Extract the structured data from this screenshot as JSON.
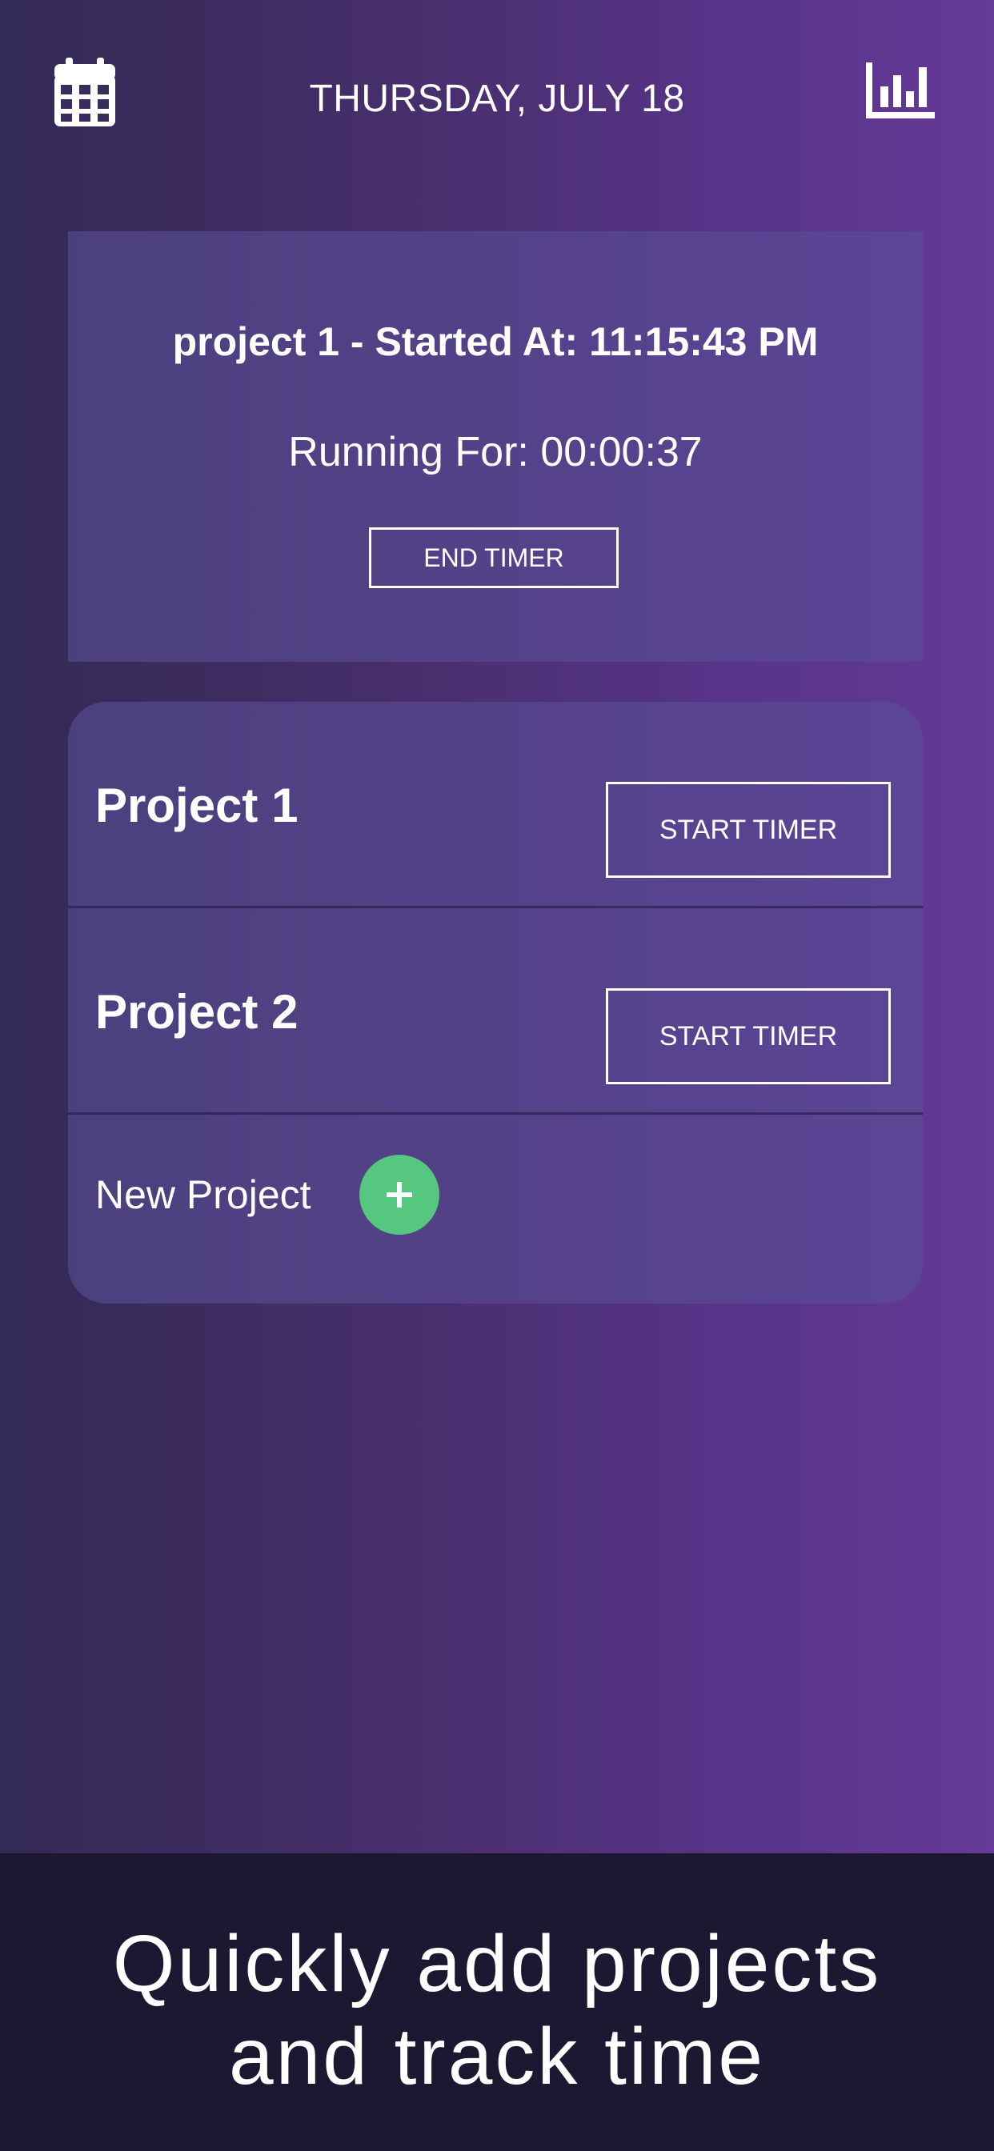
{
  "header": {
    "date": "THURSDAY, JULY 18",
    "left_icon": "calendar-icon",
    "right_icon": "bar-chart-icon"
  },
  "active_timer": {
    "started_text": "project 1 - Started At: 11:15:43 PM",
    "running_text": "Running For: 00:00:37",
    "end_button_label": "END TIMER"
  },
  "projects": [
    {
      "name": "Project 1",
      "button_label": "START TIMER"
    },
    {
      "name": "Project 2",
      "button_label": "START TIMER"
    }
  ],
  "new_project": {
    "label": "New Project",
    "add_icon": "plus-icon"
  },
  "caption": {
    "line1": "Quickly add projects",
    "line2": "and track time"
  },
  "colors": {
    "add_button": "#55c77e",
    "caption_background": "#1c1832",
    "card_background": "#4d4382"
  }
}
